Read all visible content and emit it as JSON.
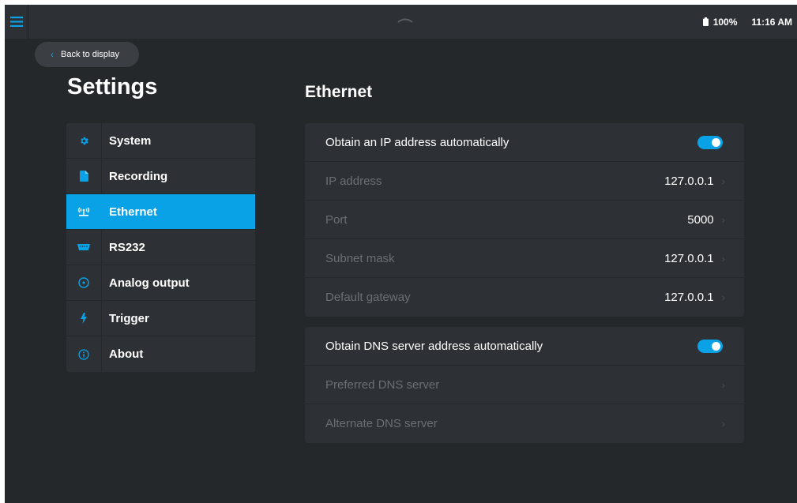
{
  "status_bar": {
    "battery_percent": "100%",
    "time": "11:16 AM"
  },
  "back_button": {
    "label": "Back to display"
  },
  "settings_title": "Settings",
  "sidebar": {
    "items": [
      {
        "label": "System",
        "icon": "gear-icon",
        "active": false
      },
      {
        "label": "Recording",
        "icon": "file-icon",
        "active": false
      },
      {
        "label": "Ethernet",
        "icon": "network-antenna-icon",
        "active": true
      },
      {
        "label": "RS232",
        "icon": "serial-port-icon",
        "active": false
      },
      {
        "label": "Analog output",
        "icon": "target-circle-icon",
        "active": false
      },
      {
        "label": "Trigger",
        "icon": "lightning-icon",
        "active": false
      },
      {
        "label": "About",
        "icon": "info-icon",
        "active": false
      }
    ]
  },
  "section_title": "Ethernet",
  "ip_panel": {
    "auto_label": "Obtain an IP address automatically",
    "auto_enabled": true,
    "rows": [
      {
        "label": "IP address",
        "value": "127.0.0.1"
      },
      {
        "label": "Port",
        "value": "5000"
      },
      {
        "label": "Subnet mask",
        "value": "127.0.0.1"
      },
      {
        "label": "Default gateway",
        "value": "127.0.0.1"
      }
    ]
  },
  "dns_panel": {
    "auto_label": "Obtain DNS server address automatically",
    "auto_enabled": true,
    "rows": [
      {
        "label": "Preferred DNS server",
        "value": ""
      },
      {
        "label": "Alternate DNS server",
        "value": ""
      }
    ]
  },
  "colors": {
    "accent": "#0aa2e6",
    "background": "#25282b",
    "panel": "#2d3034",
    "disabled_text": "#6b6f74"
  }
}
